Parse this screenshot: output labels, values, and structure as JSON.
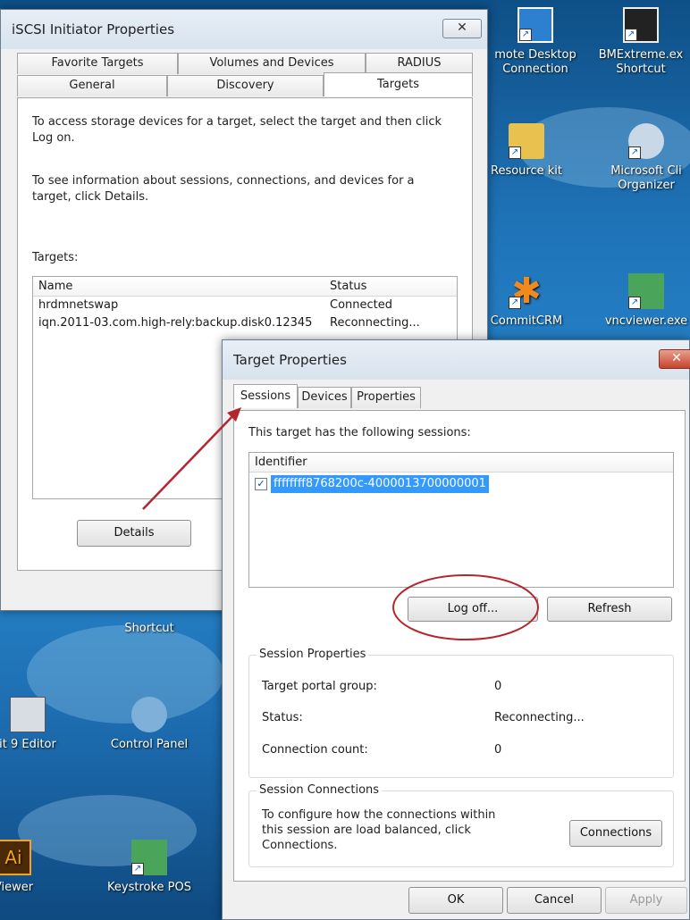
{
  "desktop": {
    "icons": [
      {
        "label1": "mote Desktop",
        "label2": "Connection"
      },
      {
        "label1": "BMExtreme.ex",
        "label2": "Shortcut"
      },
      {
        "label1": "Resource kit",
        "label2": ""
      },
      {
        "label1": "Microsoft Cli",
        "label2": "Organizer"
      },
      {
        "label1": "CommitCRM",
        "label2": ""
      },
      {
        "label1": "vncviewer.exe",
        "label2": ""
      },
      {
        "label1": "Shortcut",
        "label2": ""
      },
      {
        "label1": "it 9 Editor",
        "label2": ""
      },
      {
        "label1": "Control Panel",
        "label2": ""
      },
      {
        "label1": "Viewer",
        "label2": ""
      },
      {
        "label1": "Keystroke POS",
        "label2": ""
      }
    ]
  },
  "iscsi": {
    "title": "iSCSI Initiator Properties",
    "close": "✕",
    "tabs_top": [
      "Favorite Targets",
      "Volumes and Devices",
      "RADIUS"
    ],
    "tabs_bottom": [
      "General",
      "Discovery",
      "Targets"
    ],
    "intro1": "To access storage devices for a target, select the target and then click Log on.",
    "intro2": "To see information about sessions, connections, and devices for a target, click Details.",
    "targets_label": "Targets:",
    "columns": [
      "Name",
      "Status"
    ],
    "rows": [
      {
        "name": "hrdmnetswap",
        "status": "Connected"
      },
      {
        "name": "iqn.2011-03.com.high-rely:backup.disk0.12345",
        "status": "Reconnecting..."
      }
    ],
    "details_label": "Details"
  },
  "target_props": {
    "title": "Target Properties",
    "close": "✕",
    "tabs": [
      "Sessions",
      "Devices",
      "Properties"
    ],
    "sessions_intro": "This target has the following sessions:",
    "identifier_header": "Identifier",
    "session_id": "ffffffff8768200c-4000013700000001",
    "logoff_label": "Log off...",
    "refresh_label": "Refresh",
    "session_props_title": "Session Properties",
    "props": [
      {
        "label": "Target portal group:",
        "value": "0"
      },
      {
        "label": "Status:",
        "value": "Reconnecting..."
      },
      {
        "label": "Connection count:",
        "value": "0"
      }
    ],
    "session_conn_title": "Session Connections",
    "conn_text": "To configure how the connections within this session are load balanced, click Connections.",
    "connections_label": "Connections",
    "ok_label": "OK",
    "cancel_label": "Cancel",
    "apply_label": "Apply"
  },
  "colors": {
    "annotation_red": "#b3262e",
    "selection_blue": "#3399ff"
  }
}
